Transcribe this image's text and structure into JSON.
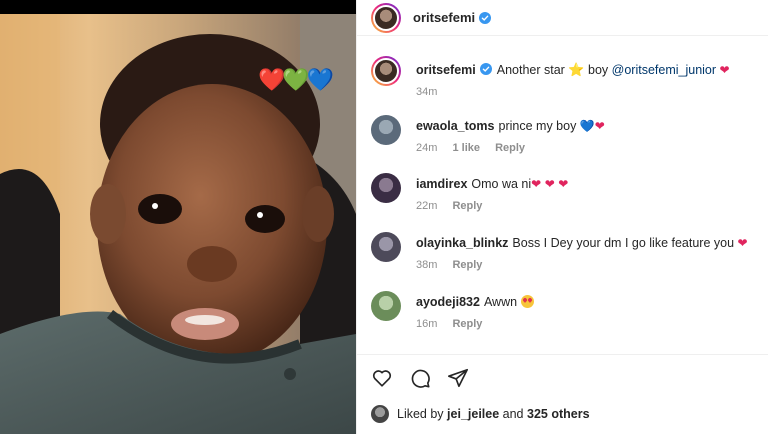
{
  "post": {
    "author": "oritsefemi",
    "sticker": "❤️💚💙"
  },
  "caption": {
    "username": "oritsefemi",
    "text_a": "Another star",
    "star": "⭐",
    "text_b": "boy",
    "mention": "@oritsefemi_junior",
    "heart": "❤",
    "time": "34m"
  },
  "comments": [
    {
      "username": "ewaola_toms",
      "text": "prince my boy",
      "emoji": [
        "💙",
        "❤"
      ],
      "time": "24m",
      "likes": "1 like",
      "reply": "Reply",
      "avatar_color": "#5b6a7a"
    },
    {
      "username": "iamdirex",
      "text": "Omo wa ni",
      "emoji": [
        "❤",
        "❤",
        "❤"
      ],
      "time": "22m",
      "likes": "",
      "reply": "Reply",
      "avatar_color": "#3a2d44"
    },
    {
      "username": "olayinka_blinkz",
      "text": "Boss I Dey your dm I go like feature you",
      "emoji": [
        "❤"
      ],
      "time": "38m",
      "likes": "",
      "reply": "Reply",
      "avatar_color": "#4d4a5a"
    },
    {
      "username": "ayodeji832",
      "text": "Awwn",
      "emoji": [
        "😍"
      ],
      "time": "16m",
      "likes": "",
      "reply": "Reply",
      "avatar_color": "#6b8d5a"
    }
  ],
  "footer": {
    "liked_prefix": "Liked by",
    "liked_user": "jei_jeilee",
    "liked_and": "and",
    "liked_others": "325 others"
  },
  "icons": [
    "heart-outline-icon",
    "comment-icon",
    "share-icon",
    "verified-icon"
  ],
  "colors": {
    "mention": "#00376b",
    "muted": "#8e8e8e",
    "verified": "#3897f0"
  }
}
